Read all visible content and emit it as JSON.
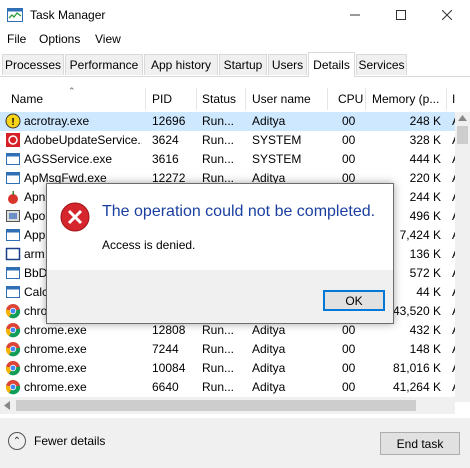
{
  "window": {
    "title": "Task Manager"
  },
  "menu": [
    "File",
    "Options",
    "View"
  ],
  "tabs": [
    "Processes",
    "Performance",
    "App history",
    "Startup",
    "Users",
    "Details",
    "Services"
  ],
  "active_tab": "Details",
  "columns": [
    "Name",
    "PID",
    "Status",
    "User name",
    "CPU",
    "Memory (p...",
    "I"
  ],
  "rows": [
    {
      "name": "acrotray.exe",
      "pid": "12696",
      "status": "Run...",
      "user": "Aditya",
      "cpu": "00",
      "mem": "248 K",
      "last": "A",
      "icon": "acrotray-icon"
    },
    {
      "name": "AdobeUpdateService...",
      "pid": "3624",
      "status": "Run...",
      "user": "SYSTEM",
      "cpu": "00",
      "mem": "328 K",
      "last": "A",
      "icon": "adobe-icon"
    },
    {
      "name": "AGSService.exe",
      "pid": "3616",
      "status": "Run...",
      "user": "SYSTEM",
      "cpu": "00",
      "mem": "444 K",
      "last": "A",
      "icon": "window-icon"
    },
    {
      "name": "ApMsgFwd.exe",
      "pid": "12272",
      "status": "Run...",
      "user": "Aditya",
      "cpu": "00",
      "mem": "220 K",
      "last": "A",
      "icon": "window-icon"
    },
    {
      "name": "Apn",
      "pid": "",
      "status": "",
      "user": "",
      "cpu": "",
      "mem": "244 K",
      "last": "A",
      "icon": "apple-icon"
    },
    {
      "name": "Apo",
      "pid": "",
      "status": "",
      "user": "",
      "cpu": "",
      "mem": "496 K",
      "last": "A",
      "icon": "generic-app-icon"
    },
    {
      "name": "App",
      "pid": "",
      "status": "",
      "user": "",
      "cpu": "",
      "mem": "7,424 K",
      "last": "A",
      "icon": "window-icon"
    },
    {
      "name": "arm",
      "pid": "",
      "status": "",
      "user": "",
      "cpu": "",
      "mem": "136 K",
      "last": "A",
      "icon": "blank-window-icon"
    },
    {
      "name": "BbD",
      "pid": "",
      "status": "",
      "user": "",
      "cpu": "",
      "mem": "572 K",
      "last": "A",
      "icon": "window-icon"
    },
    {
      "name": "Calc",
      "pid": "",
      "status": "",
      "user": "",
      "cpu": "",
      "mem": "44 K",
      "last": "A",
      "icon": "window-icon"
    },
    {
      "name": "chrom",
      "pid": "",
      "status": "",
      "user": "",
      "cpu": "",
      "mem": "43,520 K",
      "last": "A",
      "icon": "chrome-icon"
    },
    {
      "name": "chrome.exe",
      "pid": "12808",
      "status": "Run...",
      "user": "Aditya",
      "cpu": "00",
      "mem": "432 K",
      "last": "A",
      "icon": "chrome-icon"
    },
    {
      "name": "chrome.exe",
      "pid": "7244",
      "status": "Run...",
      "user": "Aditya",
      "cpu": "00",
      "mem": "148 K",
      "last": "A",
      "icon": "chrome-icon"
    },
    {
      "name": "chrome.exe",
      "pid": "10084",
      "status": "Run...",
      "user": "Aditya",
      "cpu": "00",
      "mem": "81,016 K",
      "last": "A",
      "icon": "chrome-icon"
    },
    {
      "name": "chrome.exe",
      "pid": "6640",
      "status": "Run...",
      "user": "Aditya",
      "cpu": "00",
      "mem": "41,264 K",
      "last": "A",
      "icon": "chrome-icon"
    }
  ],
  "footer": {
    "fewer_details": "Fewer details",
    "end_task": "End task"
  },
  "dialog": {
    "title": "The operation could not be completed.",
    "message": "Access is denied.",
    "ok": "OK"
  },
  "colors": {
    "selected_row": "#cde8ff",
    "dialog_title": "#1a3fa0",
    "error_red": "#d4262c"
  }
}
